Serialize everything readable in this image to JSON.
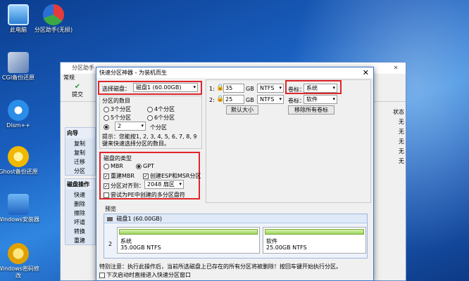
{
  "desktop": {
    "icons": [
      {
        "label": "此电脑"
      },
      {
        "label": "分区助手(无损)"
      },
      {
        "label": "CGI备份还原"
      },
      {
        "label": "Dism++"
      },
      {
        "label": "Ghost备份还原"
      },
      {
        "label": "Windows安装器"
      },
      {
        "label": "Windows密码修改"
      }
    ]
  },
  "app": {
    "title": "分区助手",
    "menu": [
      "常规"
    ],
    "toolbar": {
      "submit": "提交"
    },
    "wizard_group": {
      "title": "向导",
      "items": [
        "复制",
        "复制",
        "迁移",
        "分区"
      ]
    },
    "disk_group": {
      "title": "磁盘操作",
      "items": [
        "快速",
        "删除",
        "擦除",
        "坏道",
        "转换",
        "重建"
      ]
    },
    "right_columns": [
      "状态",
      "无",
      "无",
      "无",
      "无",
      "无"
    ]
  },
  "dialog": {
    "title": "快速分区神器 - 为装机而生",
    "select_disk_label": "选择磁盘：",
    "select_disk_value": "磁盘1 (60.00GB)",
    "partition_count_title": "分区的数目",
    "counts": [
      "3个分区",
      "4个分区",
      "5个分区",
      "6个分区"
    ],
    "custom_count_value": "2",
    "custom_count_unit": "个分区",
    "tip": "提示：您能按1, 2, 3, 4, 5, 6, 7, 8, 9键来快速选择分区的数目。",
    "disk_type_title": "磁盘的类型",
    "mbr": "MBR",
    "gpt": "GPT",
    "rebuild_mbr": "重建MBR",
    "create_esp": "创建ESP和MSR分区",
    "align_label": "分区对齐到：",
    "align_value": "2048 扇区",
    "try_pe": "尝试为PE中创建的多分区盘符",
    "rows": [
      {
        "index": "1:",
        "size": "35",
        "unit": "GB",
        "fs": "NTFS",
        "vol_label": "卷标：",
        "vol_value": "系统"
      },
      {
        "index": "2:",
        "size": "25",
        "unit": "GB",
        "fs": "NTFS",
        "vol_label": "卷标：",
        "vol_value": "软件"
      }
    ],
    "default_size_button": "默认大小",
    "remove_label_button": "移除所有卷标",
    "preview_title": "预览",
    "preview_disk": "磁盘1 (60.00GB)",
    "preview_index": "2",
    "partitions": [
      {
        "name": "系统",
        "detail": "35.00GB NTFS",
        "fraction": 0.58
      },
      {
        "name": "软件",
        "detail": "25.00GB NTFS",
        "fraction": 0.42
      }
    ],
    "warning": "特别注意：执行此操作后，当前所选磁盘上已存在的所有分区将被删除！按回车键开始执行分区。",
    "boot_checkbox": "下次启动时直接进入快速分区窗口"
  }
}
